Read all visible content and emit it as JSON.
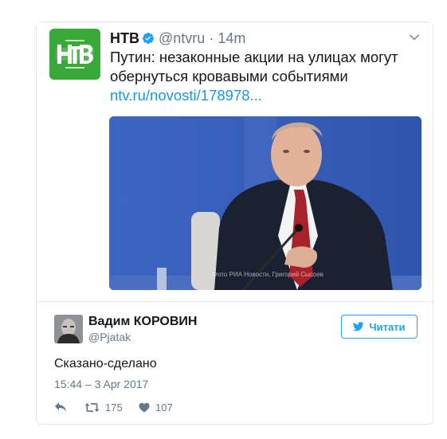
{
  "quoted_tweet": {
    "logo_text": "НТВ",
    "name": "НТВ",
    "handle": "@ntvru",
    "separator": "·",
    "time": "14m",
    "text": "Путин: незаконные акции на улицах могут обернуться кровавыми событиями ",
    "link": "ntv.ru/novosti/178978...",
    "photo_caption": "Фото РИА Новости, Григорий Сысоев"
  },
  "reply_tweet": {
    "name": "Вадим КОРОВИН",
    "handle": "@Pjatak",
    "follow_label": "Читати",
    "text": "Сказано-сделано",
    "date": "15:44 – 3 Apr 2017",
    "retweets": "175",
    "likes": "107"
  },
  "colors": {
    "accent": "#1da1f2",
    "link": "#1b95e0",
    "ntv_green": "#38a937"
  },
  "icons": [
    "verified-icon",
    "chevron-down-icon",
    "twitter-bird-icon",
    "reply-icon",
    "retweet-icon",
    "like-icon"
  ]
}
